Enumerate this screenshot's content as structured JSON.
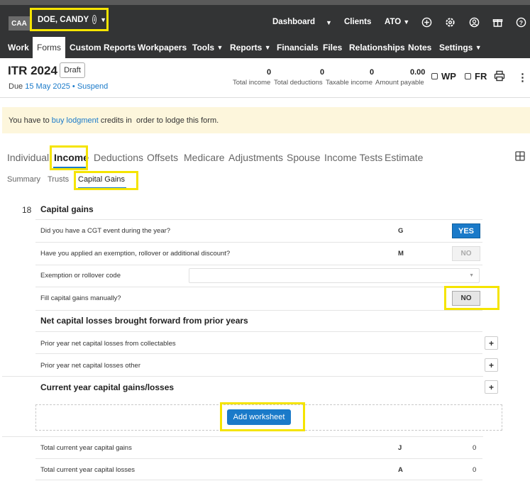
{
  "header": {
    "badge": "CAA",
    "client_name": "DOE, CANDY",
    "nav": {
      "dashboard": "Dashboard",
      "clients": "Clients",
      "ato": "ATO"
    },
    "menu": [
      "Work",
      "Forms",
      "Custom Reports",
      "Workpapers",
      "Tools",
      "Reports",
      "Financials",
      "Files",
      "Relationships",
      "Notes",
      "Settings"
    ],
    "active_menu": "Forms"
  },
  "form": {
    "title": "ITR 2024",
    "status": "Draft",
    "due_prefix": "Due ",
    "due_date": "15 May 2025",
    "due_sep": " • ",
    "suspend": "Suspend",
    "stats": [
      {
        "value": "0",
        "label": "Total income"
      },
      {
        "value": "0",
        "label": "Total deductions"
      },
      {
        "value": "0",
        "label": "Taxable income"
      },
      {
        "value": "0.00",
        "label": "Amount payable"
      }
    ],
    "wp": "WP",
    "fr": "FR"
  },
  "warning": {
    "prefix": "You have to ",
    "link": "buy lodgment",
    "suffix": " credits in  order to lodge this form."
  },
  "tabs": [
    "Individual",
    "Income",
    "Deductions",
    "Offsets",
    "Medicare",
    "Adjustments",
    "Spouse",
    "Income Tests",
    "Estimate"
  ],
  "active_tab": "Income",
  "subtabs": [
    "Summary",
    "Trusts",
    "Capital Gains"
  ],
  "active_subtab": "Capital Gains",
  "section": {
    "number": "18",
    "title": "Capital gains",
    "q1": {
      "text": "Did you have a CGT event during the year?",
      "code": "G",
      "answer": "YES"
    },
    "q2": {
      "text": "Have you applied an exemption, rollover or additional discount?",
      "code": "M",
      "answer": "NO"
    },
    "q3": {
      "text": "Exemption or rollover code",
      "value": ""
    },
    "q4": {
      "text": "Fill capital gains manually?",
      "answer": "NO"
    },
    "losses_title": "Net capital losses brought forward from prior years",
    "loss1": "Prior year net capital losses from collectables",
    "loss2": "Prior year net capital losses other",
    "current_title": "Current year capital gains/losses",
    "add_worksheet": "Add worksheet",
    "total_gains": {
      "text": "Total current year capital gains",
      "code": "J",
      "value": "0"
    },
    "total_losses": {
      "text": "Total current year capital losses",
      "code": "A",
      "value": "0"
    }
  }
}
